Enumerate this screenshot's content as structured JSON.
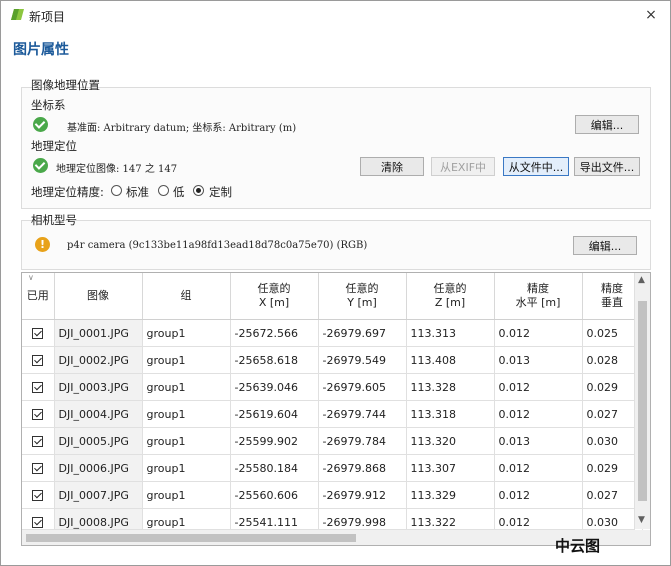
{
  "window": {
    "title": "新项目",
    "close_icon": "×"
  },
  "heading": "图片属性",
  "geo": {
    "group_title": "图像地理位置",
    "crs_label": "坐标系",
    "crs_value": "基准面: Arbitrary datum; 坐标系: Arbitrary (m)",
    "crs_edit": "编辑...",
    "geoloc_label": "地理定位",
    "geoloc_value": "地理定位图像: 147 之 147",
    "btn_clear": "清除",
    "btn_exif": "从EXIF中",
    "btn_from_file": "从文件中...",
    "btn_export": "导出文件...",
    "accuracy_label": "地理定位精度:",
    "accuracy_options": [
      "标准",
      "低",
      "定制"
    ],
    "accuracy_selected": "定制"
  },
  "camera": {
    "group_title": "相机型号",
    "value": "p4r camera (9c133be11a98fd13ead18d78c0a75e70) (RGB)",
    "edit": "编辑..."
  },
  "table": {
    "headers": {
      "enabled": "已用",
      "image": "图像",
      "group": "组",
      "x": [
        "任意的",
        "X [m]"
      ],
      "y": [
        "任意的",
        "Y [m]"
      ],
      "z": [
        "任意的",
        "Z [m]"
      ],
      "acc_h": [
        "精度",
        "水平 [m]"
      ],
      "acc_v": [
        "精度",
        "垂直"
      ]
    },
    "rows": [
      {
        "image": "DJI_0001.JPG",
        "group": "group1",
        "x": "-25672.566",
        "y": "-26979.697",
        "z": "113.313",
        "h": "0.012",
        "v": "0.025"
      },
      {
        "image": "DJI_0002.JPG",
        "group": "group1",
        "x": "-25658.618",
        "y": "-26979.549",
        "z": "113.408",
        "h": "0.013",
        "v": "0.028"
      },
      {
        "image": "DJI_0003.JPG",
        "group": "group1",
        "x": "-25639.046",
        "y": "-26979.605",
        "z": "113.328",
        "h": "0.012",
        "v": "0.029"
      },
      {
        "image": "DJI_0004.JPG",
        "group": "group1",
        "x": "-25619.604",
        "y": "-26979.744",
        "z": "113.318",
        "h": "0.012",
        "v": "0.027"
      },
      {
        "image": "DJI_0005.JPG",
        "group": "group1",
        "x": "-25599.902",
        "y": "-26979.784",
        "z": "113.320",
        "h": "0.013",
        "v": "0.030"
      },
      {
        "image": "DJI_0006.JPG",
        "group": "group1",
        "x": "-25580.184",
        "y": "-26979.868",
        "z": "113.307",
        "h": "0.012",
        "v": "0.029"
      },
      {
        "image": "DJI_0007.JPG",
        "group": "group1",
        "x": "-25560.606",
        "y": "-26979.912",
        "z": "113.329",
        "h": "0.012",
        "v": "0.027"
      },
      {
        "image": "DJI_0008.JPG",
        "group": "group1",
        "x": "-25541.111",
        "y": "-26979.998",
        "z": "113.322",
        "h": "0.012",
        "v": "0.030"
      }
    ]
  },
  "watermark": "中云图",
  "colors": {
    "heading": "#1c5a9a",
    "ok": "#4aa84a",
    "warn": "#e8a21a"
  }
}
